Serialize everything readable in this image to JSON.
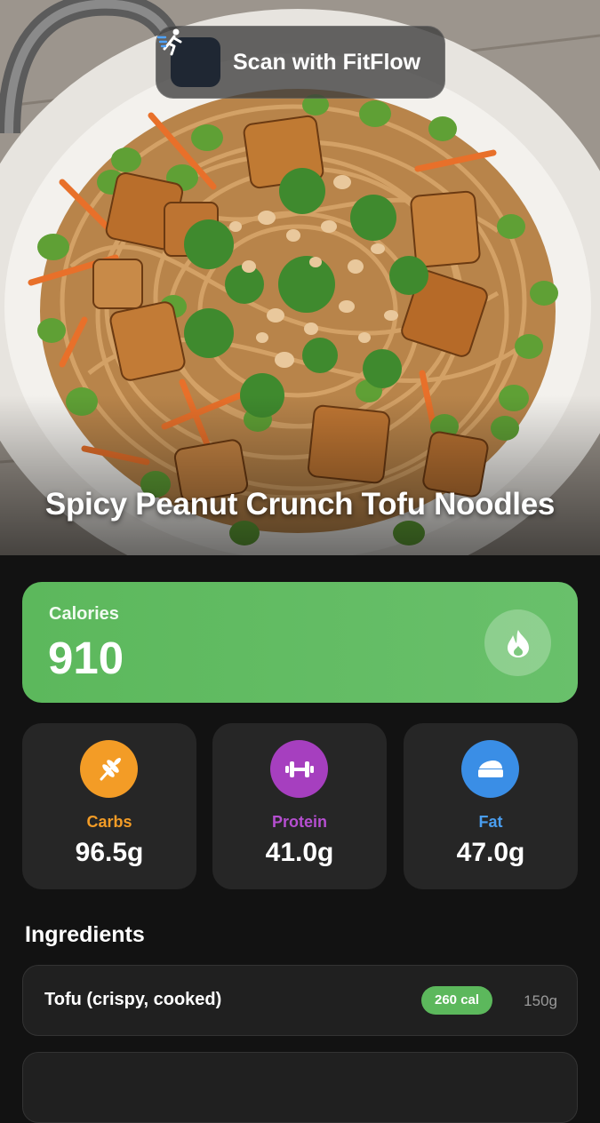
{
  "hero": {
    "scan_button_label": "Scan with FitFlow",
    "scan_logo_icon": "running-figure-icon",
    "dish_title": "Spicy Peanut Crunch Tofu Noodles"
  },
  "calories": {
    "label": "Calories",
    "value": "910",
    "icon": "flame-icon",
    "color": "#5cb85c"
  },
  "macros": [
    {
      "name": "Carbs",
      "value": "96.5g",
      "icon": "wheat-icon",
      "color": "#f39c26"
    },
    {
      "name": "Protein",
      "value": "41.0g",
      "icon": "dumbbell-icon",
      "color": "#a63fbf"
    },
    {
      "name": "Fat",
      "value": "47.0g",
      "icon": "butter-icon",
      "color": "#3a8ee6"
    }
  ],
  "ingredients": {
    "title": "Ingredients",
    "items": [
      {
        "name": "Tofu (crispy, cooked)",
        "calories": "260 cal",
        "weight": "150g"
      },
      {
        "name": "",
        "calories": "",
        "weight": ""
      }
    ]
  }
}
